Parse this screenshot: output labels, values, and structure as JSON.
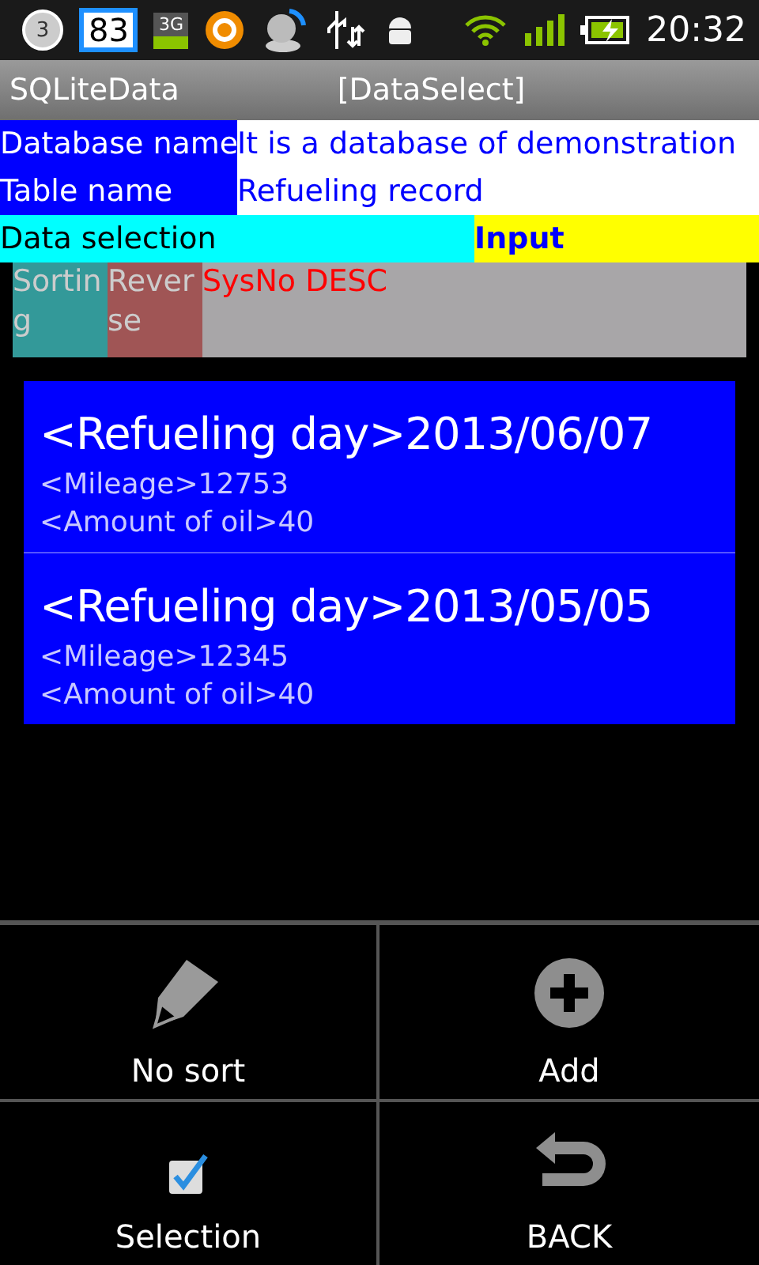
{
  "status_bar": {
    "notification_count": "3",
    "widget_number": "83",
    "network_badge": "3G",
    "time": "20:32"
  },
  "title_bar": {
    "app_name": "SQLiteData",
    "screen": "[DataSelect]"
  },
  "info_rows": [
    {
      "label": "Database name",
      "value": "It is a database of demonstration"
    },
    {
      "label": "Table name",
      "value": "Refueling record"
    }
  ],
  "selection_bar": {
    "label": "Data selection",
    "button": "Input"
  },
  "sort_bar": {
    "sorting": "Sorting",
    "reverse": "Reverse",
    "order": "SysNo DESC"
  },
  "records": [
    {
      "title": "<Refueling day>2013/06/07",
      "mileage": "<Mileage>12753",
      "oil": "<Amount of oil>40"
    },
    {
      "title": "<Refueling day>2013/05/05",
      "mileage": "<Mileage>12345",
      "oil": "<Amount of oil>40"
    }
  ],
  "menu": [
    {
      "kind": "pencil",
      "label": "No sort"
    },
    {
      "kind": "add",
      "label": "Add"
    },
    {
      "kind": "check",
      "label": "Selection"
    },
    {
      "kind": "back",
      "label": "BACK"
    }
  ]
}
